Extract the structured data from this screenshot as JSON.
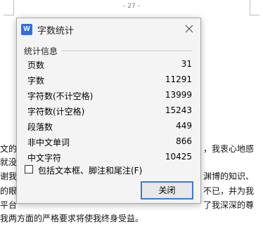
{
  "document": {
    "page_number": "- 27 -",
    "lines": [
      {
        "left": "文的",
        "right": "，我衷心地感"
      },
      {
        "left": "就没",
        "right": ""
      },
      {
        "left": "谢我的",
        "right": "渊博的知识、"
      },
      {
        "left": "的眼",
        "right": "不已，并为我"
      },
      {
        "left": "平台",
        "right": "了我深深的尊"
      },
      {
        "left": "我两方面的严格要求将使我终身受益。",
        "right": ""
      }
    ]
  },
  "dialog": {
    "title": "字数统计",
    "app_icon": "W",
    "group_title": "统计信息",
    "stats": [
      {
        "label": "页数",
        "value": "31"
      },
      {
        "label": "字数",
        "value": "11291"
      },
      {
        "label": "字符数(不计空格)",
        "value": "13999"
      },
      {
        "label": "字符数(计空格)",
        "value": "15243"
      },
      {
        "label": "段落数",
        "value": "449"
      },
      {
        "label": "非中文单词",
        "value": "866"
      },
      {
        "label": "中文字符",
        "value": "10425"
      }
    ],
    "checkbox_label": "包括文本框、脚注和尾注(F)",
    "checkbox_checked": false,
    "close_button": "关闭"
  },
  "colors": {
    "accent": "#3a7bd5",
    "app_icon": "#2f6fe0"
  }
}
